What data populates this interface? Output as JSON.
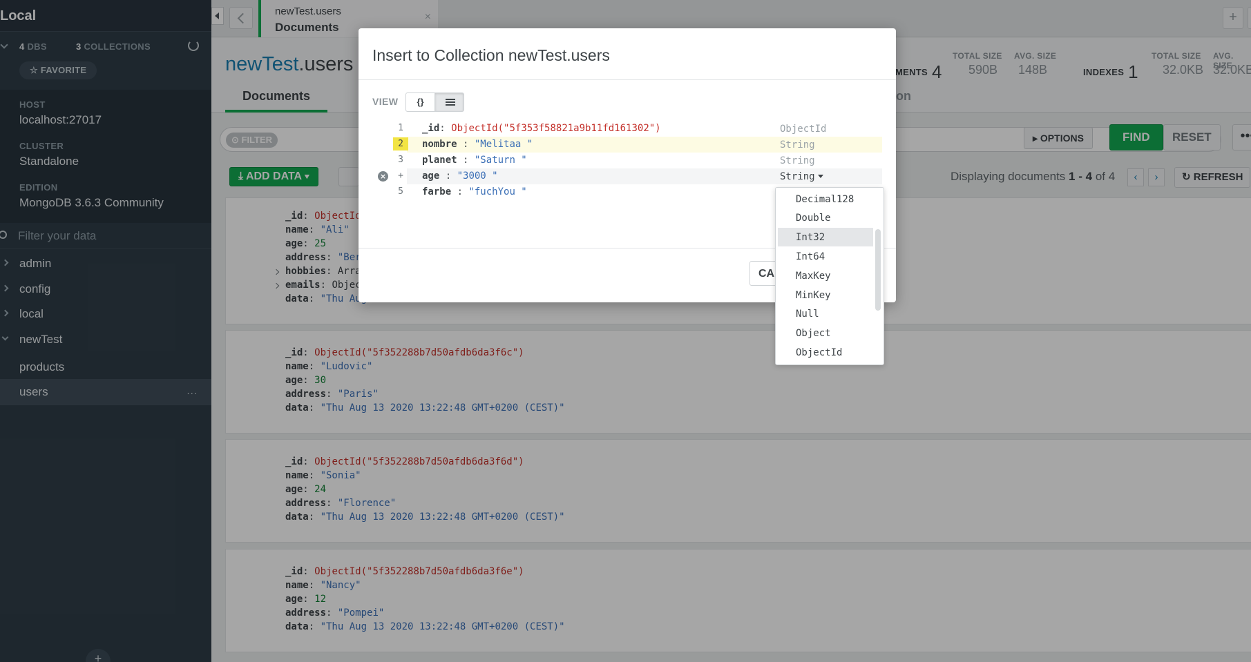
{
  "sidebar": {
    "title": "Local",
    "dbs_count": "4",
    "dbs_label": "DBS",
    "collections_count": "3",
    "collections_label": "COLLECTIONS",
    "favorite_label": "FAVORITE",
    "host_label": "HOST",
    "host_value": "localhost:27017",
    "cluster_label": "CLUSTER",
    "cluster_value": "Standalone",
    "edition_label": "EDITION",
    "edition_value": "MongoDB 3.6.3 Community",
    "filter_placeholder": "Filter your data",
    "databases": [
      {
        "name": "admin"
      },
      {
        "name": "config"
      },
      {
        "name": "local"
      },
      {
        "name": "newTest"
      }
    ],
    "collections": [
      {
        "name": "products"
      },
      {
        "name": "users"
      }
    ],
    "more_label": "...",
    "add_label": "+"
  },
  "tab": {
    "namespace": "newTest.users",
    "subtitle": "Documents",
    "close": "×",
    "add": "+"
  },
  "header": {
    "db": "newTest",
    "coll": ".users",
    "documents_label": "MENTS",
    "documents_count": "4",
    "total_size_label": "TOTAL SIZE",
    "total_size": "590B",
    "avg_size_label": "AVG. SIZE",
    "avg_size": "148B",
    "indexes_label": "INDEXES",
    "indexes_count": "1",
    "idx_total_size_label": "TOTAL SIZE",
    "idx_total_size": "32.0KB",
    "idx_avg_size_label": "AVG. SIZE",
    "idx_avg_size": "32.0KB",
    "tab_documents": "Documents",
    "tab_validation_partial": "tion"
  },
  "filterbar": {
    "filter_label": "FILTER",
    "options_label": "OPTIONS",
    "find_label": "FIND",
    "reset_label": "RESET",
    "more_label": "•••"
  },
  "toolbar": {
    "add_data_label": "ADD DATA",
    "display_prefix": "Displaying documents",
    "range": "1 - 4",
    "of_label": "of",
    "total": "4",
    "prev": "‹",
    "next": "›",
    "refresh_label": "REFRESH"
  },
  "documents": [
    {
      "lines": [
        {
          "key": "_id",
          "value": "ObjectId(",
          "kind": "oid"
        },
        {
          "key": "name",
          "value": "\"Ali\"",
          "kind": "str"
        },
        {
          "key": "age",
          "value": "25",
          "kind": "num"
        },
        {
          "key": "address",
          "value": "\"Berl",
          "kind": "str"
        },
        {
          "key": "hobbies",
          "value": "Array",
          "kind": "plain"
        },
        {
          "key": "emails",
          "value": "Object",
          "kind": "plain"
        },
        {
          "key": "data",
          "value": "\"Thu Aug",
          "kind": "str"
        }
      ]
    },
    {
      "lines": [
        {
          "key": "_id",
          "value": "ObjectId(\"5f352288b7d50afdb6da3f6c\")",
          "kind": "oid"
        },
        {
          "key": "name",
          "value": "\"Ludovic\"",
          "kind": "str"
        },
        {
          "key": "age",
          "value": "30",
          "kind": "num"
        },
        {
          "key": "address",
          "value": "\"Paris\"",
          "kind": "str"
        },
        {
          "key": "data",
          "value": "\"Thu Aug 13 2020 13:22:48 GMT+0200 (CEST)\"",
          "kind": "str"
        }
      ]
    },
    {
      "lines": [
        {
          "key": "_id",
          "value": "ObjectId(\"5f352288b7d50afdb6da3f6d\")",
          "kind": "oid"
        },
        {
          "key": "name",
          "value": "\"Sonia\"",
          "kind": "str"
        },
        {
          "key": "age",
          "value": "24",
          "kind": "num"
        },
        {
          "key": "address",
          "value": "\"Florence\"",
          "kind": "str"
        },
        {
          "key": "data",
          "value": "\"Thu Aug 13 2020 13:22:48 GMT+0200 (CEST)\"",
          "kind": "str"
        }
      ]
    },
    {
      "lines": [
        {
          "key": "_id",
          "value": "ObjectId(\"5f352288b7d50afdb6da3f6e\")",
          "kind": "oid"
        },
        {
          "key": "name",
          "value": "\"Nancy\"",
          "kind": "str"
        },
        {
          "key": "age",
          "value": "12",
          "kind": "num"
        },
        {
          "key": "address",
          "value": "\"Pompei\"",
          "kind": "str"
        },
        {
          "key": "data",
          "value": "\"Thu Aug 13 2020 13:22:48 GMT+0200 (CEST)\"",
          "kind": "str"
        }
      ]
    }
  ],
  "modal": {
    "title": "Insert to Collection newTest.users",
    "view_label": "VIEW",
    "json_view_label": "{}",
    "rows": [
      {
        "line": "1",
        "key": "_id",
        "sep": ":",
        "value": "ObjectId(\"5f353f58821a9b11fd161302\")",
        "kind": "oid",
        "type": "ObjectId"
      },
      {
        "line": "2",
        "key": "nombre",
        "sep": " :",
        "value": "\"Melitaa \"",
        "kind": "str",
        "type": "String"
      },
      {
        "line": "3",
        "key": "planet",
        "sep": " :",
        "value": "\"Saturn \"",
        "kind": "str",
        "type": "String"
      },
      {
        "line": "+",
        "key": "age",
        "sep": " :",
        "value": "\"3000 \"",
        "kind": "str",
        "type": "String"
      },
      {
        "line": "5",
        "key": "farbe",
        "sep": " :",
        "value": "\"fuchYou \"",
        "kind": "str",
        "type": ""
      }
    ],
    "cancel_label": "CANCEL"
  },
  "type_dropdown": {
    "options": [
      "Decimal128",
      "Double",
      "Int32",
      "Int64",
      "MaxKey",
      "MinKey",
      "Null",
      "Object",
      "ObjectId"
    ],
    "highlighted": "Int32"
  },
  "colors": {
    "accent_green": "#13aa52",
    "sidebar_bg": "#2f3d48",
    "object_id_red": "#c4302a",
    "string_blue": "#3b6fb6",
    "number_green": "#138036"
  }
}
